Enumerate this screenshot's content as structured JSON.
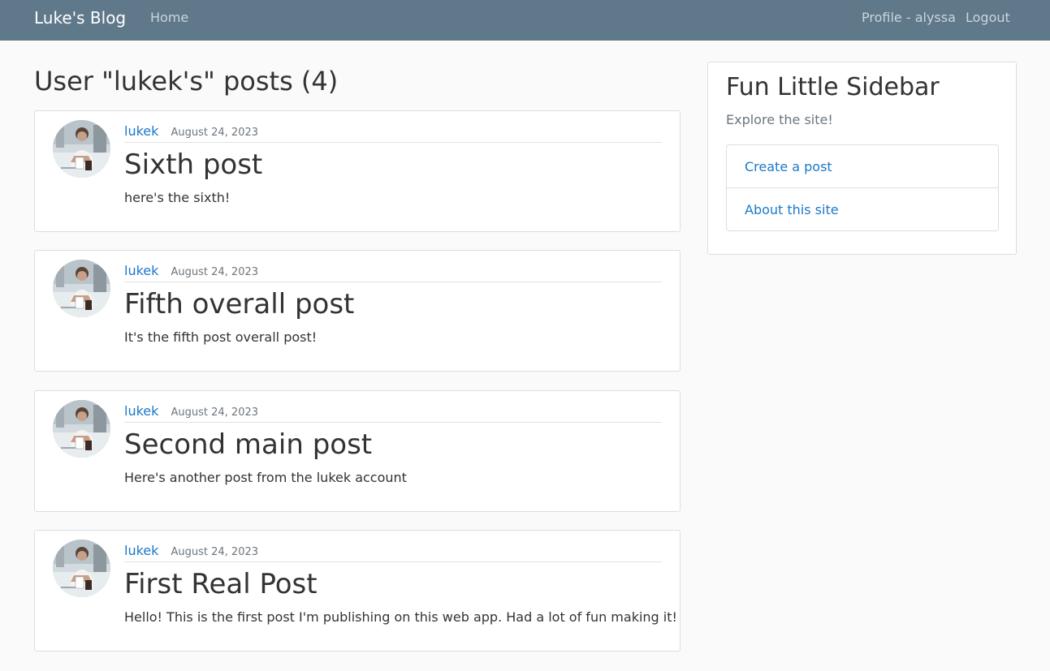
{
  "navbar": {
    "brand": "Luke's Blog",
    "home": "Home",
    "profile": "Profile - alyssa",
    "logout": "Logout"
  },
  "page": {
    "title": "User \"lukek's\" posts (4)"
  },
  "posts": [
    {
      "author": "lukek",
      "date": "August 24, 2023",
      "title": "Sixth post",
      "content": "here's the sixth!"
    },
    {
      "author": "lukek",
      "date": "August 24, 2023",
      "title": "Fifth overall post",
      "content": "It's the fifth post overall post!"
    },
    {
      "author": "lukek",
      "date": "August 24, 2023",
      "title": "Second main post",
      "content": "Here's another post from the lukek account"
    },
    {
      "author": "lukek",
      "date": "August 24, 2023",
      "title": "First Real Post",
      "content": "Hello! This is the first post I'm publishing on this web app. Had a lot of fun making it!"
    }
  ],
  "sidebar": {
    "title": "Fun Little Sidebar",
    "subtitle": "Explore the site!",
    "links": [
      "Create a post",
      "About this site"
    ]
  },
  "colors": {
    "navbar_bg": "#5f788a",
    "link": "#1b78c8",
    "page_bg": "#fafafa"
  }
}
